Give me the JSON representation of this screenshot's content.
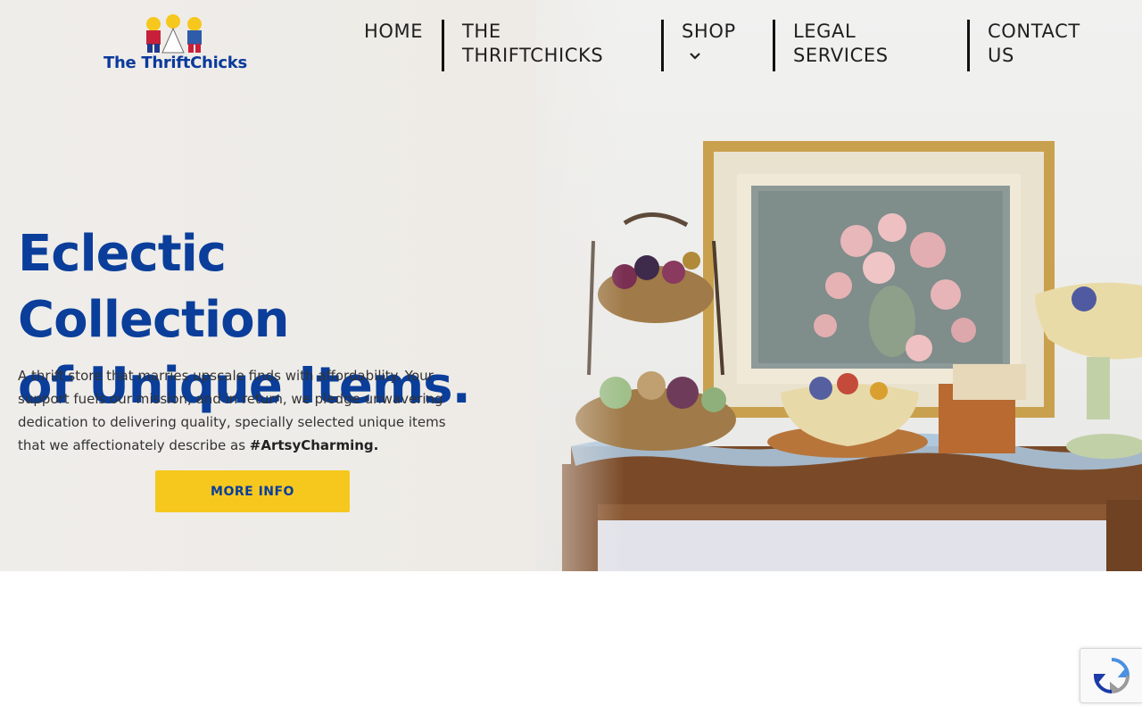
{
  "brand": {
    "name": "The ThriftChicks"
  },
  "nav": {
    "home": "HOME",
    "thriftchicks_1": "THE",
    "thriftchicks_2": "THRIFTCHICKS",
    "shop": "SHOP",
    "legal_1": "LEGAL",
    "legal_2": "SERVICES",
    "contact_1": "CONTACT",
    "contact_2": "US"
  },
  "hero": {
    "title_line1": "Eclectic Collection",
    "title_line2": "of Unique Items.",
    "description": "A thrift store that marries upscale finds with affordability. Your support fuels our mission, and in return, we pledge unwavering dedication to delivering quality, specially selected unique items that we affectionately describe as ",
    "hashtag": "#ArtsyCharming.",
    "button_label": "MORE INFO"
  },
  "icons": {
    "shop_dropdown": "chevron-down-icon",
    "recaptcha": "recaptcha-icon"
  },
  "colors": {
    "brand_blue": "#0a3e9a",
    "button_yellow": "#f6c81e",
    "nav_text": "#1f1f1f"
  }
}
